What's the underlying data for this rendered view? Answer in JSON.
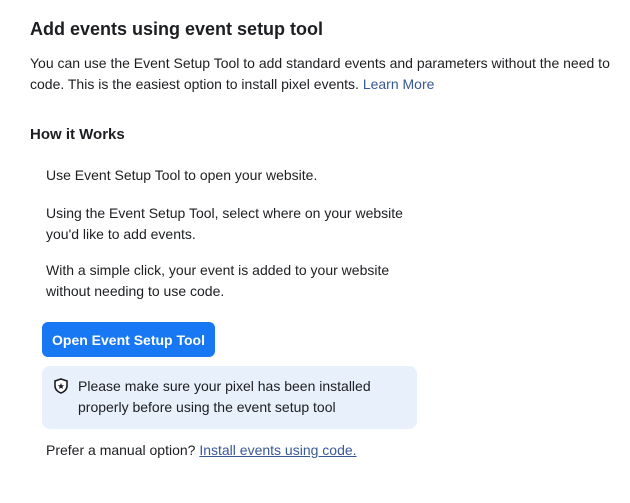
{
  "title": "Add events using event setup tool",
  "intro": {
    "text": "You can use the Event Setup Tool to add standard events and parameters without the need to code. This is the easiest option to install pixel events.",
    "link": "Learn More"
  },
  "how_title": "How it Works",
  "steps": [
    "Use Event Setup Tool to open your website.",
    "Using the Event Setup Tool, select where on your website you'd like to add events.",
    "With a simple click, your event is added to your website without needing to use code."
  ],
  "button": "Open Event Setup Tool",
  "notice": {
    "icon": "shield-star-icon",
    "text": "Please make sure your pixel has been installed properly before using the event setup tool"
  },
  "prefer": {
    "text": "Prefer a manual option?",
    "link": "Install events using code."
  },
  "colors": {
    "primary": "#1877f2",
    "link": "#385898",
    "notice_bg": "#e7f0fb"
  }
}
